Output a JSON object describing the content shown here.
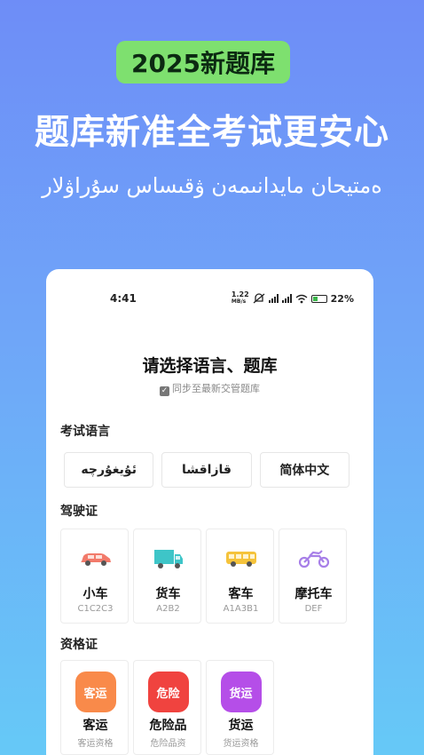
{
  "promo": {
    "badge": "2025新题库",
    "headline": "题库新准全考试更安心",
    "subline": "ەمتيحان مايدانىمەن ۋقىساس سۇراۋلار"
  },
  "status_bar": {
    "time": "4:41",
    "speed_value": "1.22",
    "speed_unit": "MB/s",
    "battery": "22%"
  },
  "page": {
    "title": "请选择语言、题库",
    "sync_label": "同步至最新交管题库"
  },
  "exam_language": {
    "title": "考试语言",
    "options": [
      "ئۇيغۇرچە",
      "قازاقشا",
      "简体中文"
    ]
  },
  "license": {
    "title": "驾驶证",
    "items": [
      {
        "name": "小车",
        "code": "C1C2C3",
        "icon": "car-icon",
        "color": "#f27a6a"
      },
      {
        "name": "货车",
        "code": "A2B2",
        "icon": "truck-icon",
        "color": "#3ec5c8"
      },
      {
        "name": "客车",
        "code": "A1A3B1",
        "icon": "bus-icon",
        "color": "#f5c33b"
      },
      {
        "name": "摩托车",
        "code": "DEF",
        "icon": "motorcycle-icon",
        "color": "#a77fe8"
      }
    ]
  },
  "qualification": {
    "title": "资格证",
    "items": [
      {
        "badge": "客运",
        "name": "客运",
        "sub": "客运资格",
        "color": "#f98a4a"
      },
      {
        "badge": "危险",
        "name": "危险品",
        "sub": "危险品资",
        "color": "#f0433f"
      },
      {
        "badge": "货运",
        "name": "货运",
        "sub": "货运资格",
        "color": "#b54ee8"
      }
    ]
  }
}
